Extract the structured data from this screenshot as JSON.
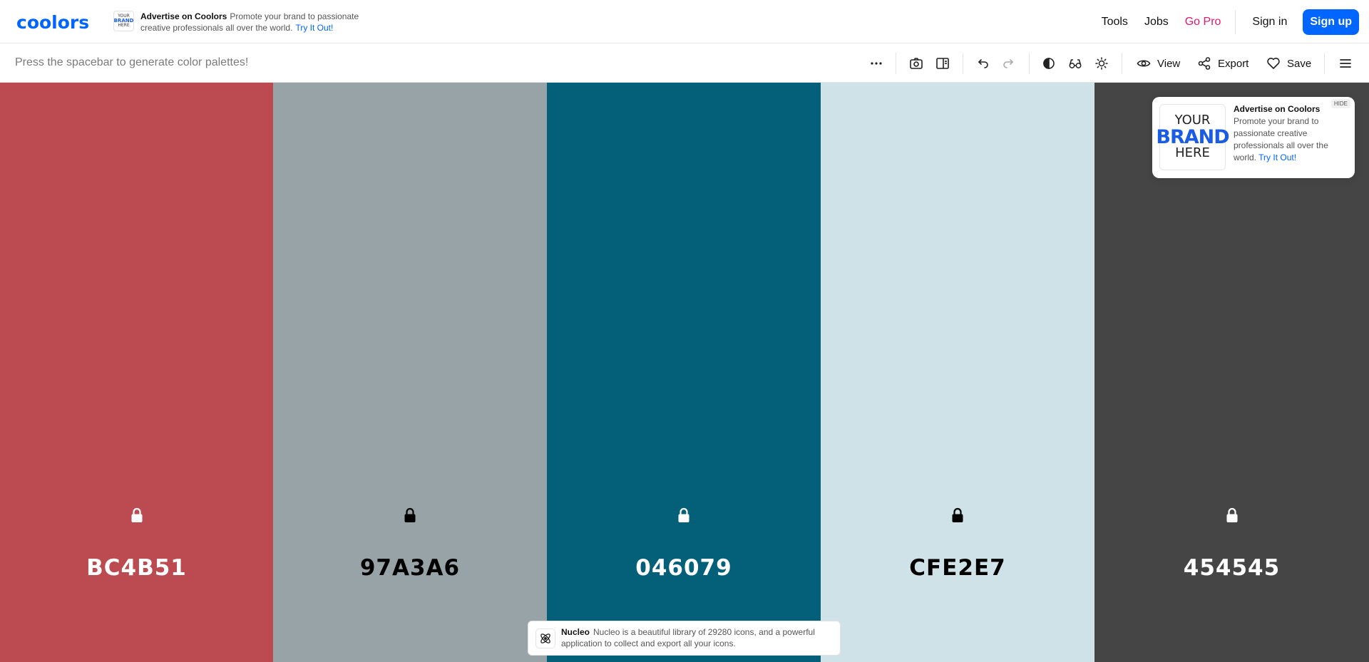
{
  "app": {
    "logo_text": "coolors",
    "brand_color": "#0066ff"
  },
  "top_ad": {
    "title": "Advertise on Coolors",
    "text": "Promote your brand to passionate creative professionals all over the world.",
    "link": "Try It Out!",
    "thumb": [
      "YOUR",
      "BRAND",
      "HERE"
    ]
  },
  "nav": {
    "tools": "Tools",
    "jobs": "Jobs",
    "go_pro": "Go Pro",
    "sign_in": "Sign in",
    "sign_up": "Sign up"
  },
  "toolbar": {
    "hint": "Press the spacebar to generate color palettes!",
    "view": "View",
    "export": "Export",
    "save": "Save",
    "icons": [
      "more-icon",
      "camera-icon",
      "side-panel-icon",
      "undo-icon",
      "redo-icon",
      "contrast-icon",
      "glasses-icon",
      "sun-icon",
      "eye-icon",
      "share-icon",
      "heart-icon",
      "menu-icon"
    ]
  },
  "palette": [
    {
      "hex": "BC4B51",
      "bg": "#BC4B51",
      "fg": "#ffffff"
    },
    {
      "hex": "97A3A6",
      "bg": "#97A3A6",
      "fg": "#000000"
    },
    {
      "hex": "046079",
      "bg": "#046079",
      "fg": "#ffffff"
    },
    {
      "hex": "CFE2E7",
      "bg": "#CFE2E7",
      "fg": "#000000"
    },
    {
      "hex": "454545",
      "bg": "#454545",
      "fg": "#ffffff"
    }
  ],
  "card_ad": {
    "title": "Advertise on Coolors",
    "text": "Promote your brand to passionate creative professionals all over the world.",
    "link": "Try It Out!",
    "hide": "HIDE",
    "logo": [
      "YOUR",
      "BRAND",
      "HERE"
    ]
  },
  "toast": {
    "title": "Nucleo",
    "text": "Nucleo is a beautiful library of 29280 icons, and a powerful application to collect and export all your icons."
  }
}
